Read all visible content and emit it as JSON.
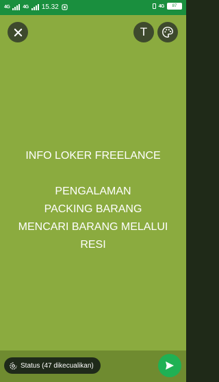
{
  "statusbar": {
    "time": "15.32",
    "network_left": "4G",
    "network_right": "4G",
    "battery": "87",
    "icons": [
      "signal-icon",
      "whatsapp-notification-icon",
      "vibrate-icon",
      "battery-icon"
    ]
  },
  "toolbar": {
    "close_icon": "close-icon",
    "text_label": "T",
    "palette_icon": "palette-icon"
  },
  "status": {
    "lines": [
      "INFO LOKER FREELANCE",
      "",
      "PENGALAMAN",
      "PACKING BARANG",
      "MENCARI BARANG MELALUI",
      "RESI"
    ],
    "background_color": "#8bab3f",
    "text_color": "#ffffff"
  },
  "footer": {
    "privacy_label": "Status (47 dikecualikan)",
    "privacy_icon": "status-privacy-icon",
    "send_icon": "send-icon",
    "send_color": "#1fb154"
  }
}
